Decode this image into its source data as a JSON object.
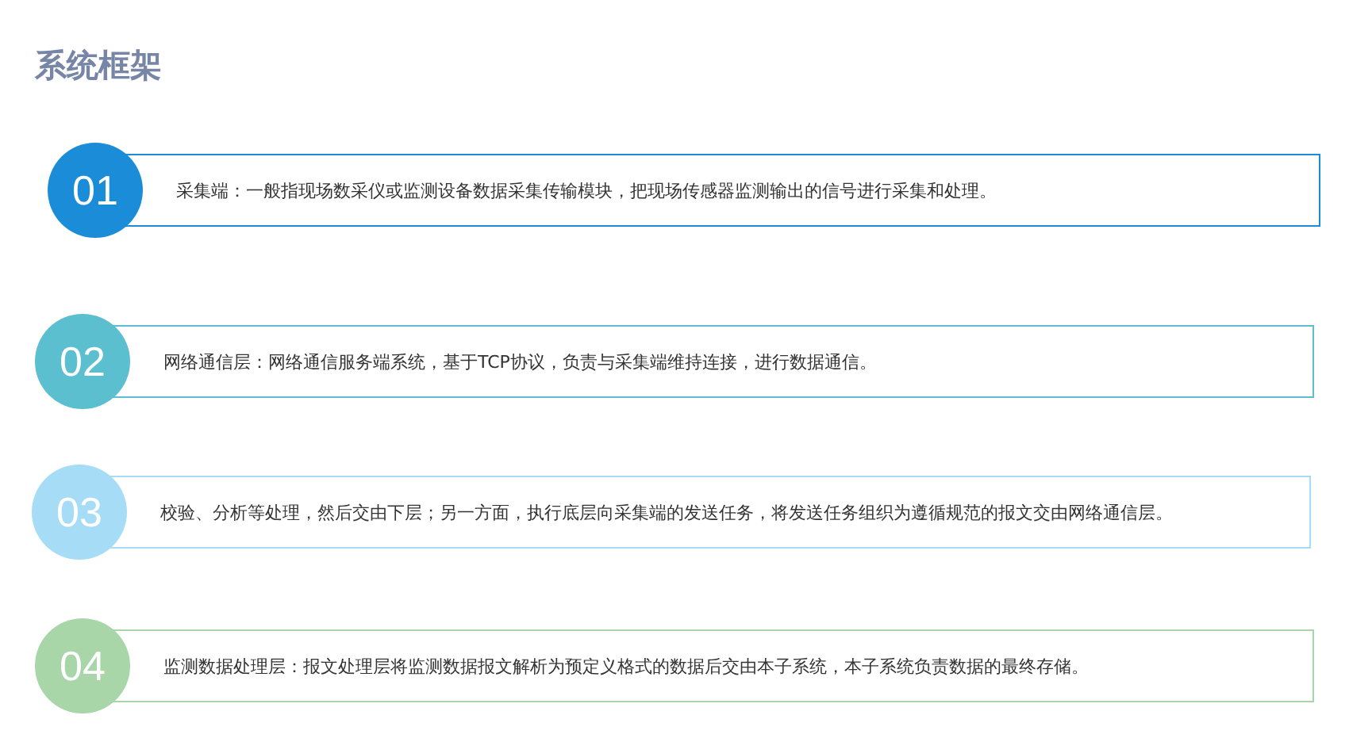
{
  "title": "系统框架",
  "items": [
    {
      "number": "01",
      "text": "采集端：一般指现场数采仪或监测设备数据采集传输模块，把现场传感器监测输出的信号进行采集和处理。",
      "color": "#1a8cd8"
    },
    {
      "number": "02",
      "text": "网络通信层：网络通信服务端系统，基于TCP协议，负责与采集端维持连接，进行数据通信。",
      "color": "#5bbfcf"
    },
    {
      "number": "03",
      "text": "校验、分析等处理，然后交由下层；另一方面，执行底层向采集端的发送任务，将发送任务组织为遵循规范的报文交由网络通信层。",
      "color": "#a6dcf6"
    },
    {
      "number": "04",
      "text": "监测数据处理层：报文处理层将监测数据报文解析为预定义格式的数据后交由本子系统，本子系统负责数据的最终存储。",
      "color": "#a9d6a9"
    }
  ]
}
